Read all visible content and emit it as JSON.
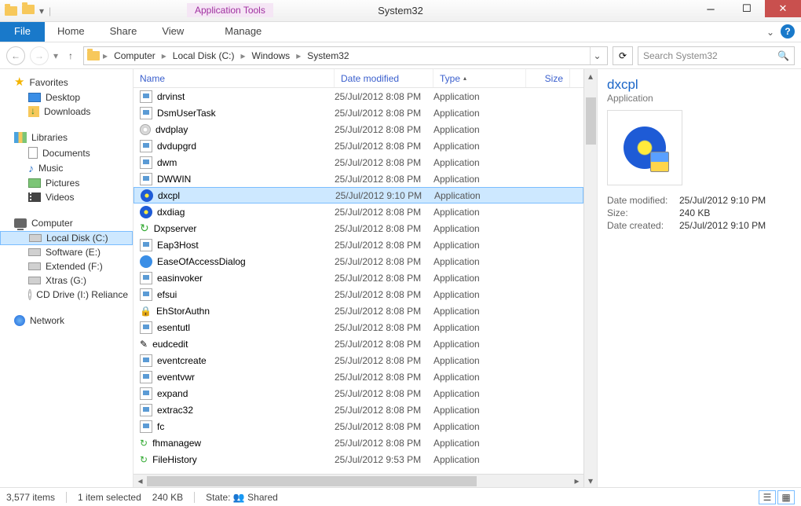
{
  "window": {
    "title": "System32",
    "contextual_tab": "Application Tools"
  },
  "ribbon": {
    "file": "File",
    "tabs": [
      "Home",
      "Share",
      "View",
      "Manage"
    ]
  },
  "nav": {
    "back_enabled": true,
    "forward_enabled": false,
    "breadcrumbs": [
      "Computer",
      "Local Disk (C:)",
      "Windows",
      "System32"
    ]
  },
  "search": {
    "placeholder": "Search System32"
  },
  "tree": {
    "favorites": {
      "label": "Favorites",
      "items": [
        "Desktop",
        "Downloads"
      ]
    },
    "libraries": {
      "label": "Libraries",
      "items": [
        "Documents",
        "Music",
        "Pictures",
        "Videos"
      ]
    },
    "computer": {
      "label": "Computer",
      "items": [
        "Local Disk (C:)",
        "Software (E:)",
        "Extended (F:)",
        "Xtras (G:)",
        "CD Drive (I:) Reliance"
      ],
      "selected_index": 0
    },
    "network": {
      "label": "Network"
    }
  },
  "columns": {
    "name": "Name",
    "date": "Date modified",
    "type": "Type",
    "size": "Size",
    "sort_column": "type",
    "sort_dir": "asc"
  },
  "files": [
    {
      "name": "drvinst",
      "date": "25/Jul/2012 8:08 PM",
      "type": "Application",
      "icon": "app"
    },
    {
      "name": "DsmUserTask",
      "date": "25/Jul/2012 8:08 PM",
      "type": "Application",
      "icon": "app"
    },
    {
      "name": "dvdplay",
      "date": "25/Jul/2012 8:08 PM",
      "type": "Application",
      "icon": "dvd"
    },
    {
      "name": "dvdupgrd",
      "date": "25/Jul/2012 8:08 PM",
      "type": "Application",
      "icon": "app"
    },
    {
      "name": "dwm",
      "date": "25/Jul/2012 8:08 PM",
      "type": "Application",
      "icon": "app"
    },
    {
      "name": "DWWIN",
      "date": "25/Jul/2012 8:08 PM",
      "type": "Application",
      "icon": "app"
    },
    {
      "name": "dxcpl",
      "date": "25/Jul/2012 9:10 PM",
      "type": "Application",
      "icon": "dxcpl",
      "selected": true
    },
    {
      "name": "dxdiag",
      "date": "25/Jul/2012 8:08 PM",
      "type": "Application",
      "icon": "dxcpl"
    },
    {
      "name": "Dxpserver",
      "date": "25/Jul/2012 8:08 PM",
      "type": "Application",
      "icon": "green"
    },
    {
      "name": "Eap3Host",
      "date": "25/Jul/2012 8:08 PM",
      "type": "Application",
      "icon": "app"
    },
    {
      "name": "EaseOfAccessDialog",
      "date": "25/Jul/2012 8:08 PM",
      "type": "Application",
      "icon": "ease"
    },
    {
      "name": "easinvoker",
      "date": "25/Jul/2012 8:08 PM",
      "type": "Application",
      "icon": "app"
    },
    {
      "name": "efsui",
      "date": "25/Jul/2012 8:08 PM",
      "type": "Application",
      "icon": "app"
    },
    {
      "name": "EhStorAuthn",
      "date": "25/Jul/2012 8:08 PM",
      "type": "Application",
      "icon": "lock"
    },
    {
      "name": "esentutl",
      "date": "25/Jul/2012 8:08 PM",
      "type": "Application",
      "icon": "app"
    },
    {
      "name": "eudcedit",
      "date": "25/Jul/2012 8:08 PM",
      "type": "Application",
      "icon": "edit"
    },
    {
      "name": "eventcreate",
      "date": "25/Jul/2012 8:08 PM",
      "type": "Application",
      "icon": "app"
    },
    {
      "name": "eventvwr",
      "date": "25/Jul/2012 8:08 PM",
      "type": "Application",
      "icon": "event"
    },
    {
      "name": "expand",
      "date": "25/Jul/2012 8:08 PM",
      "type": "Application",
      "icon": "app"
    },
    {
      "name": "extrac32",
      "date": "25/Jul/2012 8:08 PM",
      "type": "Application",
      "icon": "app"
    },
    {
      "name": "fc",
      "date": "25/Jul/2012 8:08 PM",
      "type": "Application",
      "icon": "app"
    },
    {
      "name": "fhmanagew",
      "date": "25/Jul/2012 8:08 PM",
      "type": "Application",
      "icon": "fh"
    },
    {
      "name": "FileHistory",
      "date": "25/Jul/2012 9:53 PM",
      "type": "Application",
      "icon": "fh"
    }
  ],
  "preview": {
    "name": "dxcpl",
    "type": "Application",
    "meta": [
      {
        "label": "Date modified:",
        "value": "25/Jul/2012 9:10 PM"
      },
      {
        "label": "Size:",
        "value": "240 KB"
      },
      {
        "label": "Date created:",
        "value": "25/Jul/2012 9:10 PM"
      }
    ]
  },
  "status": {
    "item_count": "3,577 items",
    "selection": "1 item selected",
    "sel_size": "240 KB",
    "state_label": "State:",
    "state_value": "Shared"
  }
}
